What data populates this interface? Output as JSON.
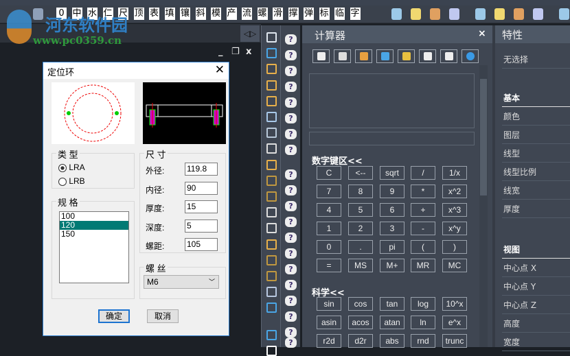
{
  "watermark": {
    "title": "河东软件园",
    "url": "www.pc0359.cn"
  },
  "toolbar": {
    "chars": [
      "0",
      "中",
      "水",
      "仁",
      "尺",
      "顶",
      "表",
      "填",
      "镶",
      "斜",
      "模",
      "产",
      "流",
      "螺",
      "滑",
      "撑",
      "弹",
      "标",
      "临",
      "字"
    ],
    "icon_groups": [
      [
        "bulb-icon",
        "bulb-yellow-icon",
        "bulb-pair-icon",
        "text-a-icon"
      ],
      [
        "ie-icon",
        "attach-icon",
        "pair-icon",
        "text-a2-icon"
      ],
      [
        "gear-icon",
        "sun-icon"
      ]
    ]
  },
  "window_controls": {
    "minimize": "_",
    "restore": "❐",
    "close": "x"
  },
  "panel_arrows": "◁▷",
  "vertical_toolbar": [
    "eraser-icon",
    "copy-icon",
    "mirror-icon",
    "offset-icon",
    "array-icon",
    "move-icon",
    "rotate-icon",
    "scale-icon",
    "stretch-icon",
    "trim-icon",
    "extend-icon",
    "break-point-icon",
    "break-icon",
    "join-icon",
    "chamfer-icon",
    "fillet-icon",
    "explode-icon",
    "edit-block-icon",
    "draw-order-icon",
    "draw-order2-icon"
  ],
  "dialog": {
    "title": "定位环",
    "close": "✕",
    "type_group": {
      "label": "类 型",
      "options": [
        "LRA",
        "LRB"
      ],
      "selected": 0
    },
    "spec_group": {
      "label": "规 格",
      "items": [
        "100",
        "120",
        "150"
      ],
      "selected": 1
    },
    "size_group": {
      "label": "尺 寸",
      "fields": [
        {
          "label": "外径:",
          "value": "119.8"
        },
        {
          "label": "内径:",
          "value": "90"
        },
        {
          "label": "厚度:",
          "value": "15"
        },
        {
          "label": "深度:",
          "value": "5"
        },
        {
          "label": "螺距:",
          "value": "105"
        }
      ]
    },
    "thread_group": {
      "label": "螺 丝",
      "value": "M6"
    },
    "ok": "确定",
    "cancel": "取消"
  },
  "calculator": {
    "title": "计算器",
    "close": "×",
    "tools": [
      "clear-icon",
      "history-icon",
      "paste-icon",
      "pick-point-icon",
      "distance-icon",
      "angle-icon",
      "intersect-icon",
      "help-icon"
    ],
    "numpad_label": "数字键区<<",
    "numpad": [
      "C",
      "<--",
      "sqrt",
      "/",
      "1/x",
      "7",
      "8",
      "9",
      "*",
      "x^2",
      "4",
      "5",
      "6",
      "+",
      "x^3",
      "1",
      "2",
      "3",
      "-",
      "x^y",
      "0",
      ".",
      "pi",
      "(",
      ")",
      "=",
      "MS",
      "M+",
      "MR",
      "MC"
    ],
    "sci_label": "科学<<",
    "sci": [
      "sin",
      "cos",
      "tan",
      "log",
      "10^x",
      "asin",
      "acos",
      "atan",
      "ln",
      "e^x",
      "r2d",
      "d2r",
      "abs",
      "rnd",
      "trunc"
    ]
  },
  "properties": {
    "title": "特性",
    "selection": "无选择",
    "sections": [
      {
        "header": "基本",
        "rows": [
          "颜色",
          "图层",
          "线型",
          "线型比例",
          "线宽",
          "厚度"
        ]
      },
      {
        "header": "视图",
        "rows": [
          "中心点 X",
          "中心点 Y",
          "中心点 Z",
          "高度",
          "宽度"
        ]
      }
    ]
  }
}
